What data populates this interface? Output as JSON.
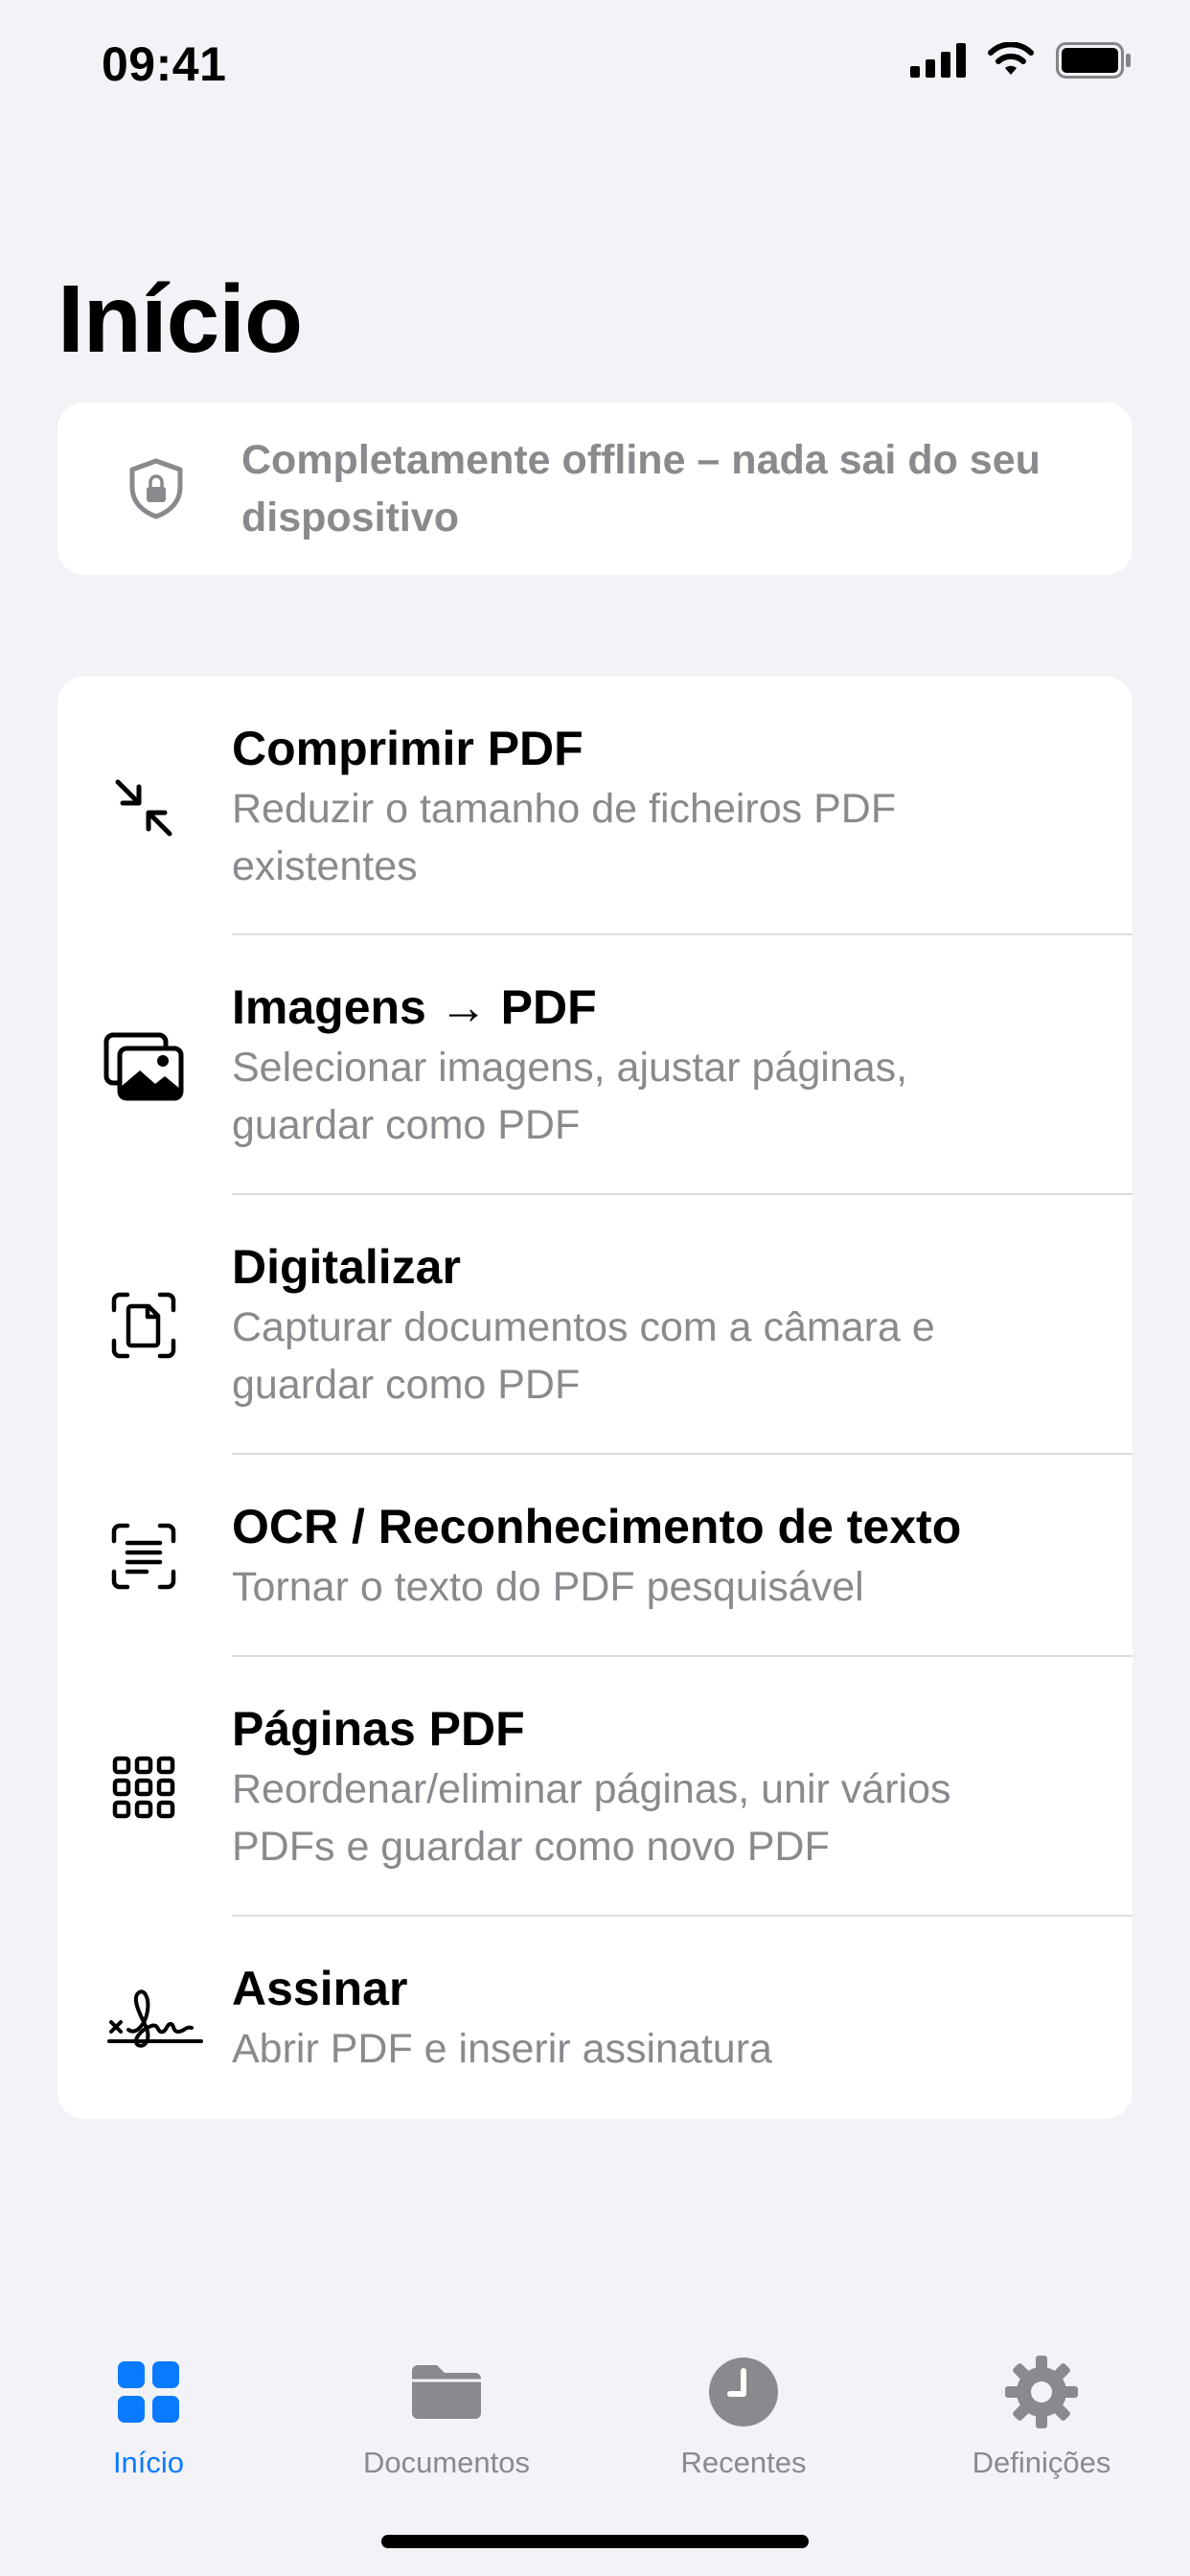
{
  "status_bar": {
    "time": "09:41"
  },
  "page_title": "Início",
  "offline_banner": {
    "icon": "lock-shield-icon",
    "text": "Completamente offline – nada sai do seu dispositivo"
  },
  "tools": [
    {
      "icon": "compress-arrows-icon",
      "title": "Comprimir PDF",
      "desc_lines": [
        "Reduzir o tamanho de ficheiros PDF",
        "existentes"
      ]
    },
    {
      "icon": "photos-icon",
      "title": "Imagens → PDF",
      "desc_lines": [
        "Selecionar imagens, ajustar páginas,",
        "guardar como PDF"
      ]
    },
    {
      "icon": "document-scanner-icon",
      "title": "Digitalizar",
      "desc_lines": [
        "Capturar documentos com a câmara e",
        "guardar como PDF"
      ]
    },
    {
      "icon": "text-viewfinder-icon",
      "title": "OCR / Reconhecimento de texto",
      "desc_lines": [
        "Tornar o texto do PDF pesquisável"
      ]
    },
    {
      "icon": "grid-icon",
      "title": "Páginas PDF",
      "desc_lines": [
        "Reordenar/eliminar páginas, unir vários",
        "PDFs e guardar como novo PDF"
      ]
    },
    {
      "icon": "signature-icon",
      "title": "Assinar",
      "desc_lines": [
        "Abrir PDF e inserir assinatura"
      ]
    }
  ],
  "tab_bar": {
    "tabs": [
      {
        "label": "Início",
        "icon": "grid-icon",
        "active": true
      },
      {
        "label": "Documentos",
        "icon": "folder-icon",
        "active": false
      },
      {
        "label": "Recentes",
        "icon": "clock-icon",
        "active": false
      },
      {
        "label": "Definições",
        "icon": "gear-icon",
        "active": false
      }
    ]
  },
  "colors": {
    "accent": "#0a7aff",
    "secondary_text": "#8a8a8e",
    "background": "#f2f2f7",
    "card": "#ffffff"
  }
}
